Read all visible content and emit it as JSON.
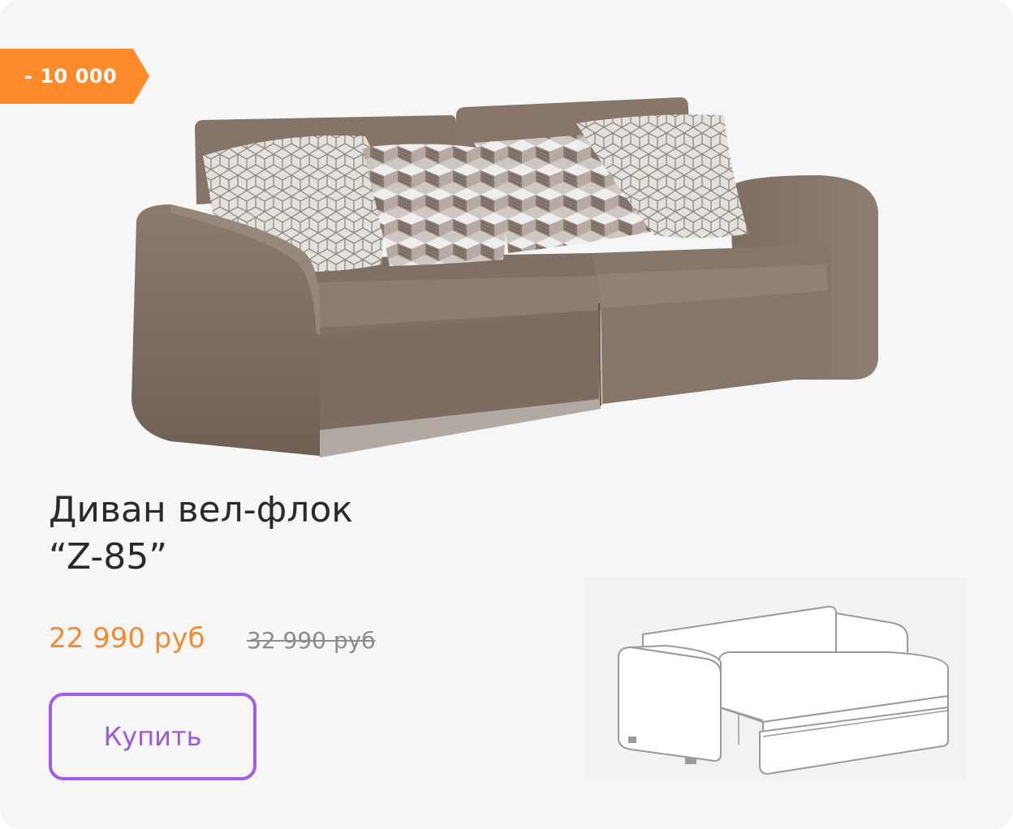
{
  "badge": {
    "discount": "- 10 000",
    "color": "#ff8a2b"
  },
  "product": {
    "title_line1": "Диван вел-флок",
    "title_line2": "“Z-85”",
    "image_icon": "sofa-photo",
    "scheme_icon": "sofa-bed-diagram"
  },
  "price": {
    "current": "22 990 руб",
    "old": "32 990 руб",
    "accent_color": "#f28a33"
  },
  "actions": {
    "buy_label": "Купить",
    "button_color": "#a45ee6"
  }
}
